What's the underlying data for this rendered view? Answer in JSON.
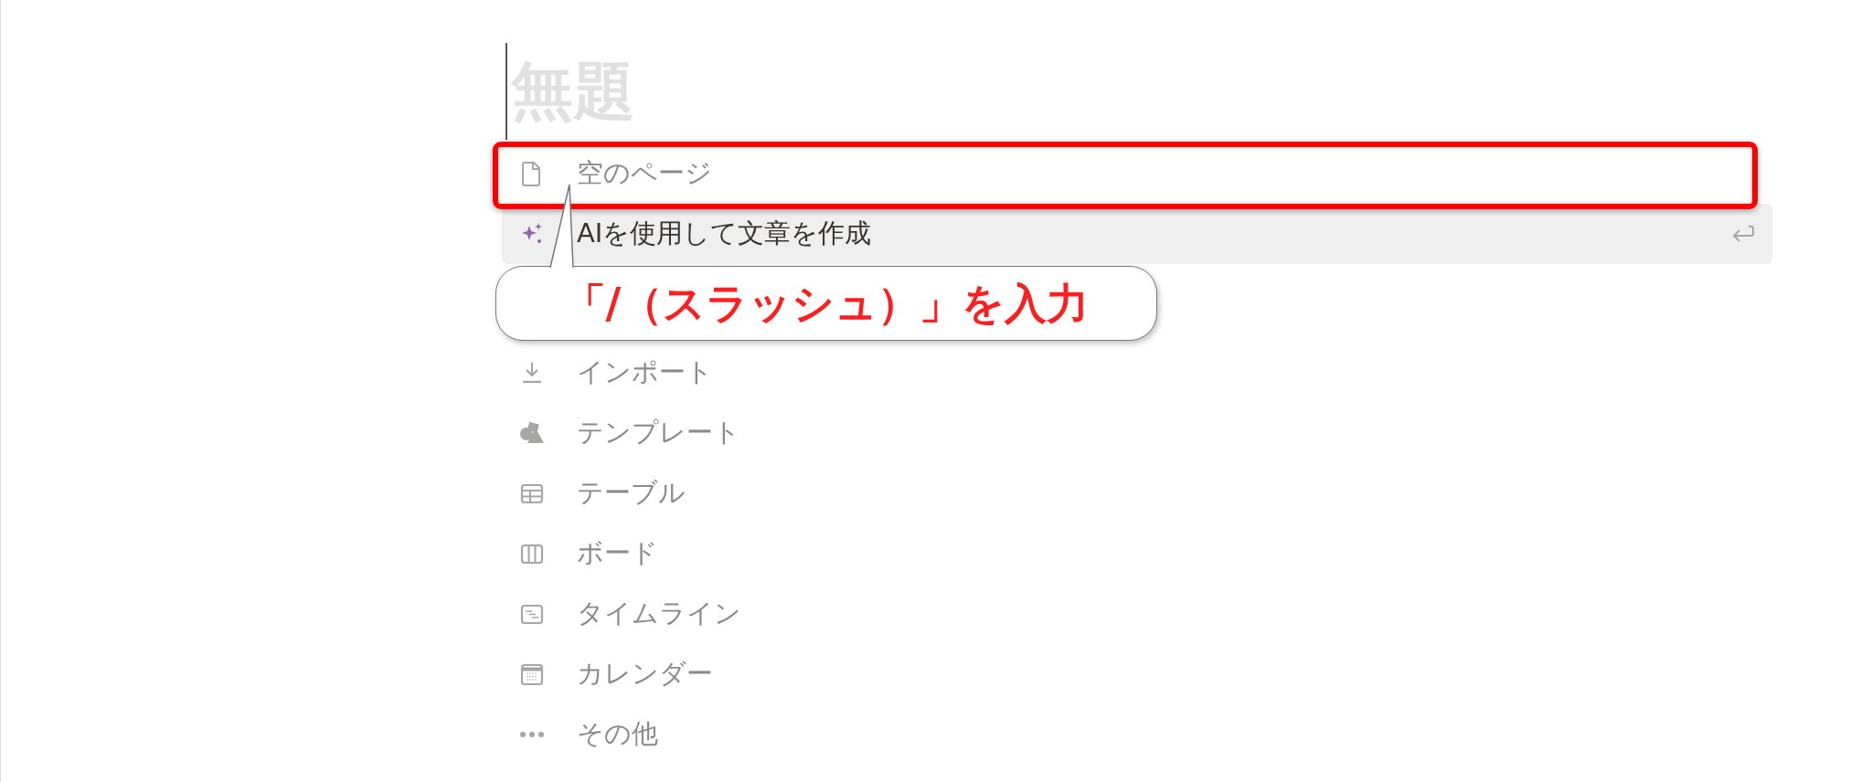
{
  "page": {
    "title": "無題"
  },
  "menu": [
    {
      "kind": "page",
      "label": "空のページ",
      "selected": false
    },
    {
      "kind": "ai",
      "label": "AIを使用して文章を作成",
      "selected": true
    },
    {
      "kind": "import",
      "label": "インポート",
      "selected": false
    },
    {
      "kind": "template",
      "label": "テンプレート",
      "selected": false
    },
    {
      "kind": "table",
      "label": "テーブル",
      "selected": false
    },
    {
      "kind": "board",
      "label": "ボード",
      "selected": false
    },
    {
      "kind": "timeline",
      "label": "タイムライン",
      "selected": false
    },
    {
      "kind": "calendar",
      "label": "カレンダー",
      "selected": false
    },
    {
      "kind": "more",
      "label": "その他",
      "selected": false
    }
  ],
  "annotation": {
    "callout": "「/（スラッシュ）」を入力"
  }
}
